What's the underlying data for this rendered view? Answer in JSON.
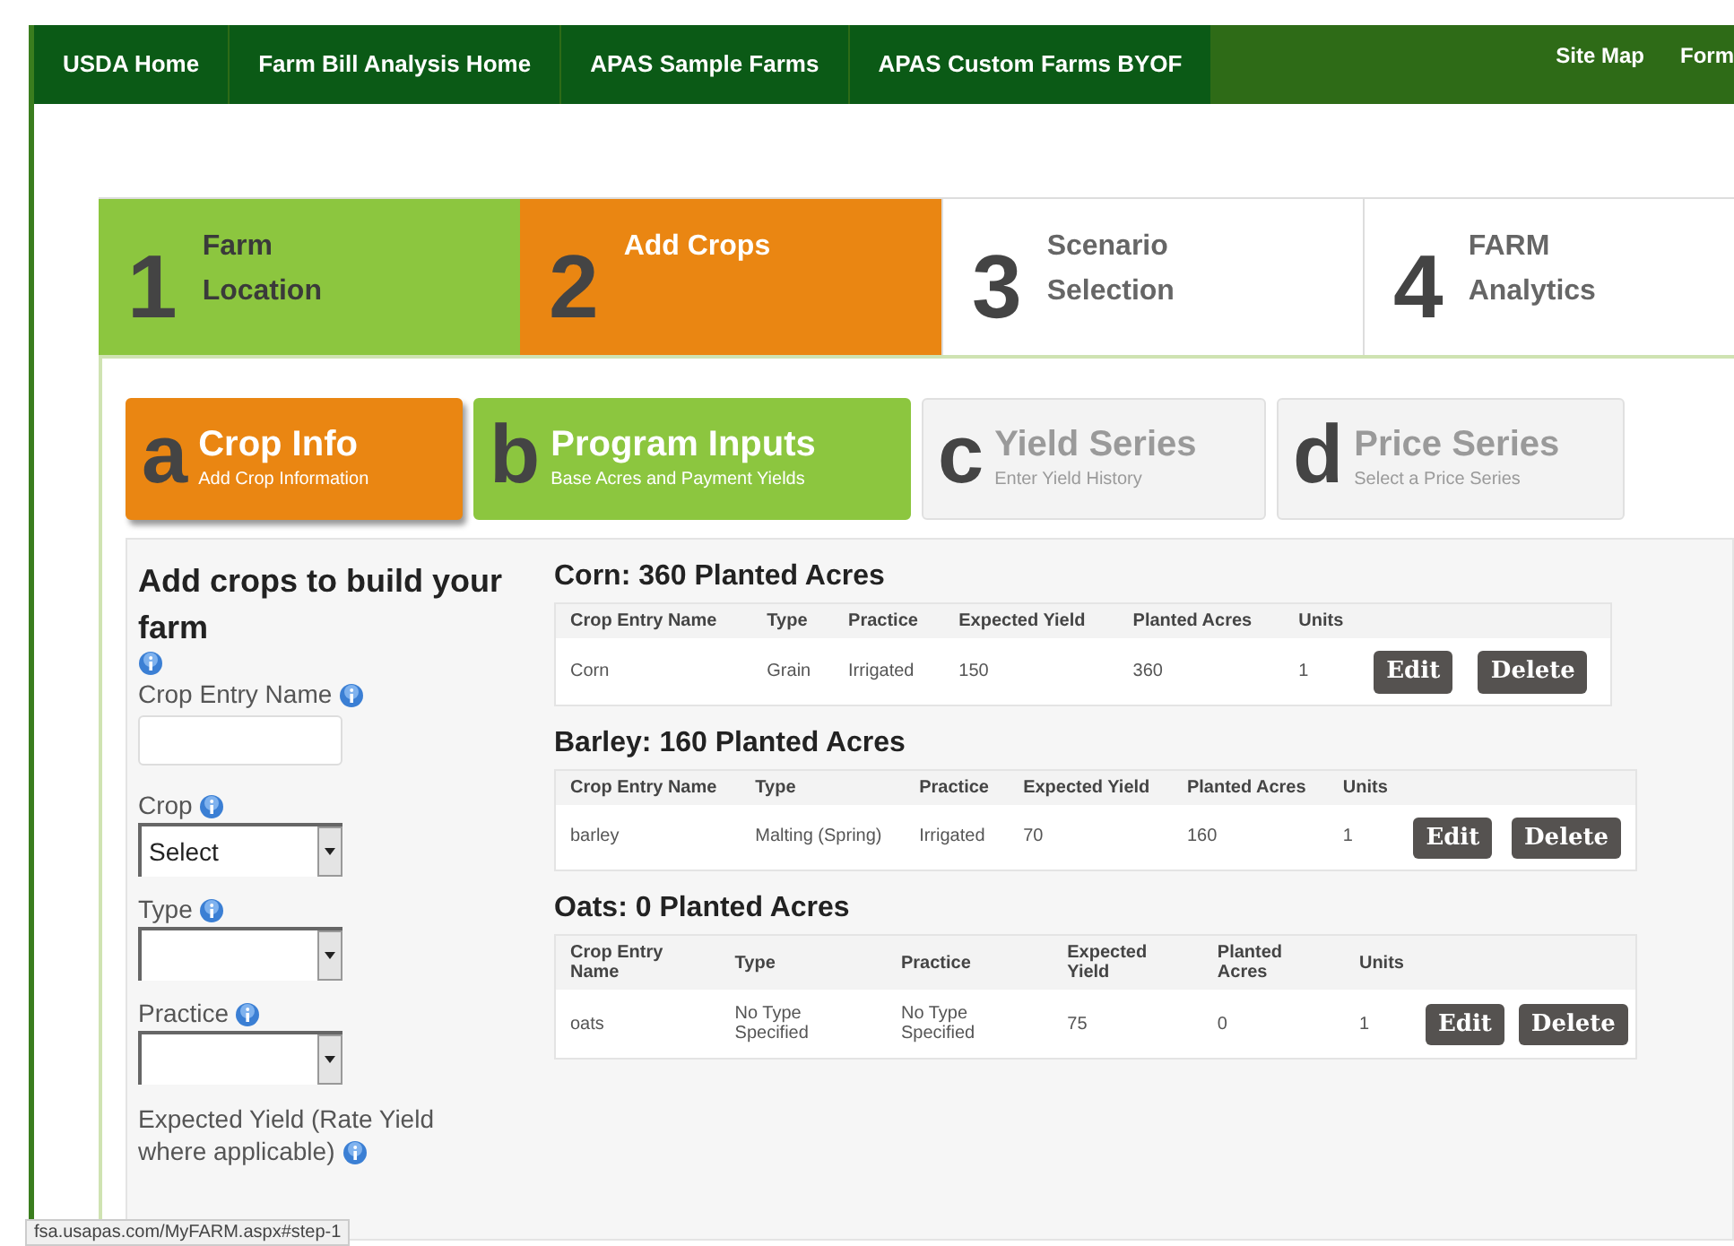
{
  "nav": {
    "items": [
      {
        "label": "USDA Home"
      },
      {
        "label": "Farm Bill Analysis Home"
      },
      {
        "label": "APAS Sample Farms"
      },
      {
        "label": "APAS Custom Farms BYOF"
      }
    ],
    "right_links": [
      {
        "label": "Site Map"
      },
      {
        "label": "Form"
      }
    ]
  },
  "steps": [
    {
      "number": "1",
      "title": "Farm Location",
      "selected": false,
      "completed": true
    },
    {
      "number": "2",
      "title": "Add Crops",
      "selected": true,
      "completed": false
    },
    {
      "number": "3",
      "title": "Scenario Selection",
      "selected": false,
      "completed": false
    },
    {
      "number": "4",
      "title": "FARM Analytics",
      "selected": false,
      "completed": false
    }
  ],
  "substeps": [
    {
      "letter": "a",
      "title": "Crop Info",
      "subtitle": "Add Crop Information",
      "selected": true,
      "completed": false,
      "disabled": false
    },
    {
      "letter": "b",
      "title": "Program Inputs",
      "subtitle": "Base Acres and Payment Yields",
      "selected": false,
      "completed": true,
      "disabled": false
    },
    {
      "letter": "c",
      "title": "Yield Series",
      "subtitle": "Enter Yield History",
      "selected": false,
      "completed": false,
      "disabled": true
    },
    {
      "letter": "d",
      "title": "Price Series",
      "subtitle": "Select a Price Series",
      "selected": false,
      "completed": false,
      "disabled": true
    }
  ],
  "form": {
    "heading": "Add crops to build your farm",
    "fields": [
      {
        "kind": "text",
        "label": "Crop Entry Name"
      },
      {
        "kind": "select",
        "label": "Crop",
        "value": "Select"
      },
      {
        "kind": "select",
        "label": "Type"
      },
      {
        "kind": "select",
        "label": "Practice"
      },
      {
        "kind": "label",
        "label": "Expected Yield (Rate Yield where applicable)"
      }
    ]
  },
  "crops": [
    {
      "title": "Corn: 360 Planted Acres",
      "columns": [
        "Crop Entry Name",
        "Type",
        "Practice",
        "Expected Yield",
        "Planted Acres",
        "Units"
      ],
      "rows": [
        {
          "cells": [
            "Corn",
            "Grain",
            "Irrigated",
            "150",
            "360",
            "1"
          ],
          "actions": [
            "Edit",
            "Delete"
          ]
        }
      ]
    },
    {
      "title": "Barley: 160 Planted Acres",
      "columns": [
        "Crop Entry Name",
        "Type",
        "Practice",
        "Expected Yield",
        "Planted Acres",
        "Units"
      ],
      "rows": [
        {
          "cells": [
            "barley",
            "Malting (Spring)",
            "Irrigated",
            "70",
            "160",
            "1"
          ],
          "actions": [
            "Edit",
            "Delete"
          ]
        }
      ]
    },
    {
      "title": "Oats: 0 Planted Acres",
      "columns": [
        "Crop Entry Name",
        "Type",
        "Practice",
        "Expected Yield",
        "Planted Acres",
        "Units"
      ],
      "rows": [
        {
          "cells": [
            "oats",
            "No Type Specified",
            "No Type Specified",
            "75",
            "0",
            "1"
          ],
          "actions": [
            "Edit",
            "Delete"
          ]
        }
      ]
    }
  ],
  "status_bar": {
    "url": "fsa.usapas.com/MyFARM.aspx#step-1"
  }
}
